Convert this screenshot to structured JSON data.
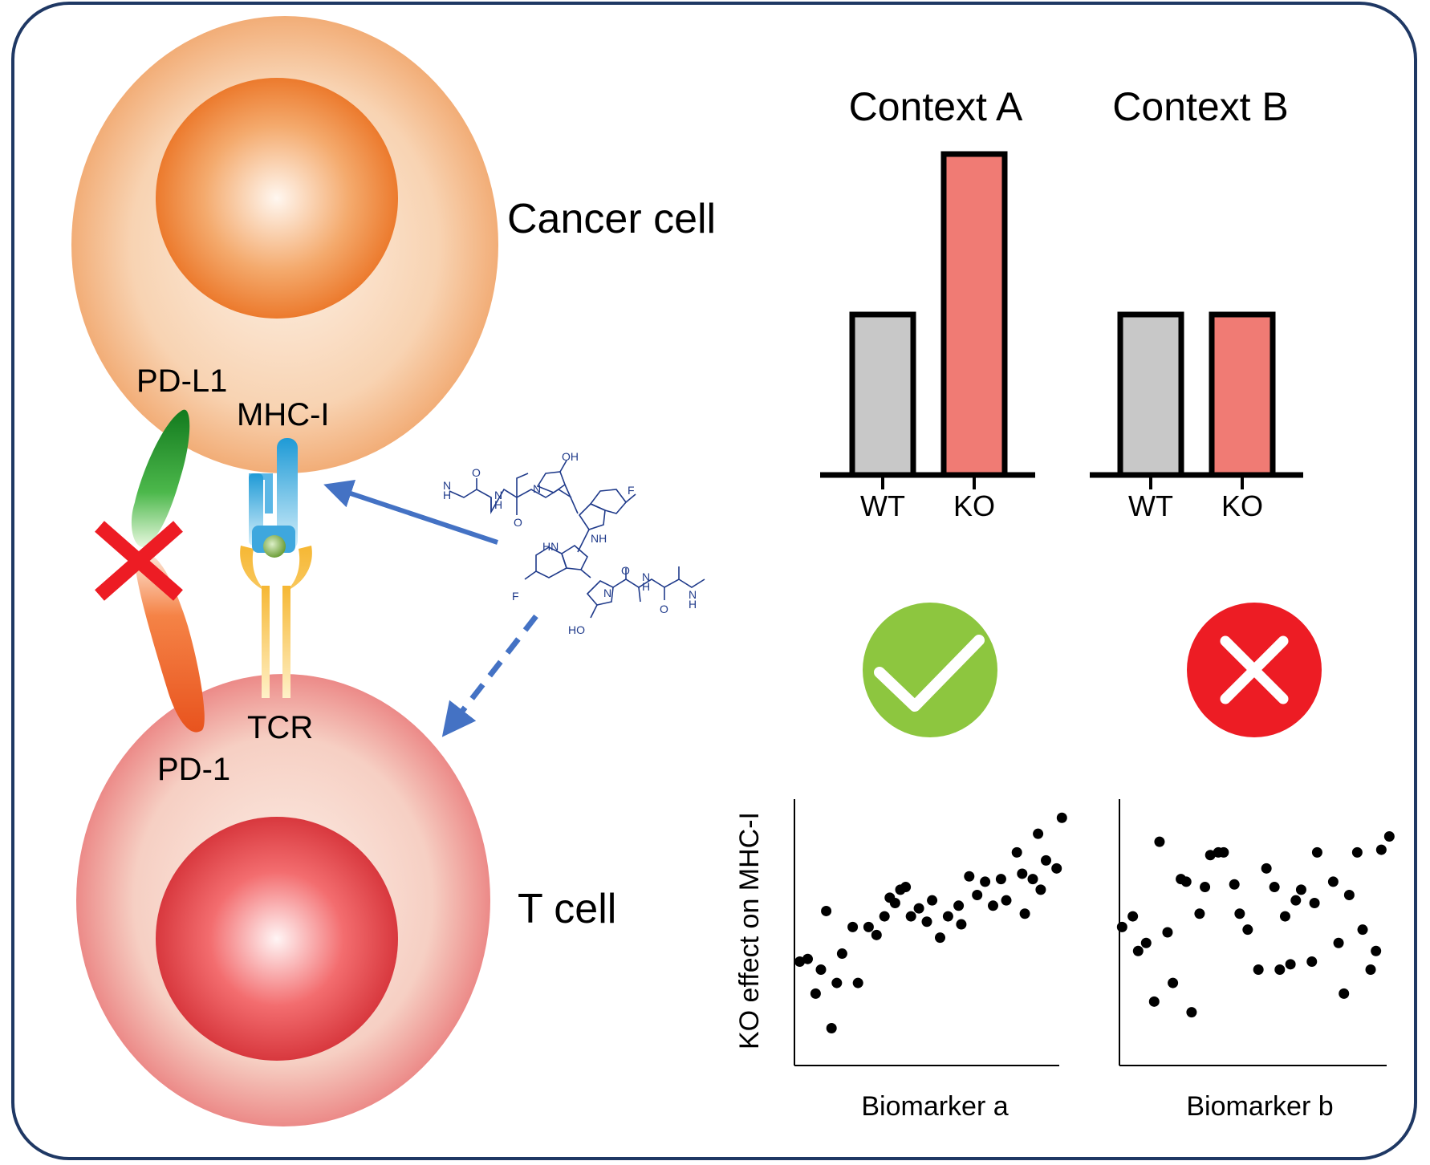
{
  "labels": {
    "cancer_cell": "Cancer cell",
    "t_cell": "T cell",
    "pd_l1": "PD-L1",
    "mhc_i": "MHC-I",
    "tcr": "TCR",
    "pd_1": "PD-1"
  },
  "compound": {
    "atoms": [
      "N",
      "H",
      "O",
      "N",
      "H",
      "O",
      "N",
      "OH",
      "F",
      "NH",
      "HN",
      "F",
      "N",
      "O",
      "N",
      "H",
      "O",
      "N",
      "H",
      "HO"
    ]
  },
  "icons": {
    "blocked": "red-x-icon",
    "success": "check-circle-icon",
    "fail": "x-circle-icon"
  },
  "colors": {
    "frame": "#1f3864",
    "wt_bar": "#c8c8c8",
    "ko_bar": "#f07b74",
    "check": "#8dc63f",
    "cross": "#ed1c24",
    "arrow": "#4472c4",
    "cancer_cell": "#f2b07c",
    "t_cell": "#ec8a88"
  },
  "chart_data": [
    {
      "type": "bar",
      "title": "Context A",
      "categories": [
        "WT",
        "KO"
      ],
      "values": [
        1.0,
        2.0
      ],
      "colors": [
        "#c8c8c8",
        "#f07b74"
      ]
    },
    {
      "type": "bar",
      "title": "Context B",
      "categories": [
        "WT",
        "KO"
      ],
      "values": [
        1.0,
        1.0
      ],
      "colors": [
        "#c8c8c8",
        "#f07b74"
      ]
    },
    {
      "type": "scatter",
      "xlabel": "Biomarker a",
      "ylabel": "KO effect on MHC-I",
      "xlim": [
        0,
        100
      ],
      "ylim": [
        0,
        100
      ],
      "points": [
        [
          2,
          39
        ],
        [
          5,
          40
        ],
        [
          10,
          36
        ],
        [
          8,
          27
        ],
        [
          14,
          14
        ],
        [
          12,
          58
        ],
        [
          18,
          42
        ],
        [
          16,
          31
        ],
        [
          24,
          31
        ],
        [
          22,
          52
        ],
        [
          28,
          52
        ],
        [
          31,
          49
        ],
        [
          34,
          56
        ],
        [
          36,
          63
        ],
        [
          40,
          66
        ],
        [
          38,
          61
        ],
        [
          42,
          67
        ],
        [
          44,
          56
        ],
        [
          47,
          59
        ],
        [
          50,
          54
        ],
        [
          52,
          62
        ],
        [
          55,
          48
        ],
        [
          58,
          56
        ],
        [
          62,
          60
        ],
        [
          66,
          71
        ],
        [
          63,
          53
        ],
        [
          69,
          64
        ],
        [
          72,
          69
        ],
        [
          75,
          60
        ],
        [
          78,
          70
        ],
        [
          80,
          62
        ],
        [
          84,
          80
        ],
        [
          86,
          72
        ],
        [
          87,
          57
        ],
        [
          90,
          70
        ],
        [
          93,
          66
        ],
        [
          95,
          77
        ],
        [
          92,
          87
        ],
        [
          99,
          74
        ],
        [
          101,
          93
        ]
      ]
    },
    {
      "type": "scatter",
      "xlabel": "Biomarker b",
      "ylabel": "",
      "xlim": [
        0,
        100
      ],
      "ylim": [
        0,
        100
      ],
      "points": [
        [
          1,
          52
        ],
        [
          5,
          56
        ],
        [
          7,
          43
        ],
        [
          10,
          46
        ],
        [
          13,
          24
        ],
        [
          15,
          84
        ],
        [
          18,
          50
        ],
        [
          20,
          31
        ],
        [
          23,
          70
        ],
        [
          25,
          69
        ],
        [
          27,
          20
        ],
        [
          30,
          57
        ],
        [
          32,
          67
        ],
        [
          34,
          79
        ],
        [
          37,
          80
        ],
        [
          39,
          80
        ],
        [
          43,
          68
        ],
        [
          45,
          57
        ],
        [
          48,
          51
        ],
        [
          52,
          36
        ],
        [
          55,
          74
        ],
        [
          58,
          67
        ],
        [
          60,
          36
        ],
        [
          62,
          56
        ],
        [
          64,
          38
        ],
        [
          66,
          62
        ],
        [
          68,
          66
        ],
        [
          72,
          39
        ],
        [
          73,
          61
        ],
        [
          74,
          80
        ],
        [
          80,
          69
        ],
        [
          82,
          46
        ],
        [
          84,
          27
        ],
        [
          86,
          64
        ],
        [
          89,
          80
        ],
        [
          91,
          51
        ],
        [
          94,
          36
        ],
        [
          96,
          43
        ],
        [
          98,
          81
        ],
        [
          101,
          86
        ]
      ]
    }
  ]
}
